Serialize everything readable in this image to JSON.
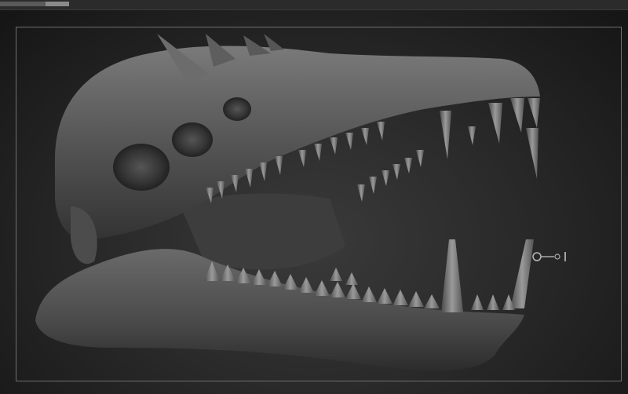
{
  "app": {
    "view": "3d-sculpt-viewport",
    "progress": 0.66
  },
  "viewport": {
    "model": "creature-skull",
    "material": "matte-grey",
    "colors": {
      "background": "#2a2a2a",
      "frame": "#6e6e6e",
      "model_base": "#5a5a5a",
      "model_highlight": "#8a8a8a",
      "model_shadow": "#2e2e2e"
    }
  },
  "icons": {
    "transpose_gizmo": "transpose-gizmo-icon"
  }
}
